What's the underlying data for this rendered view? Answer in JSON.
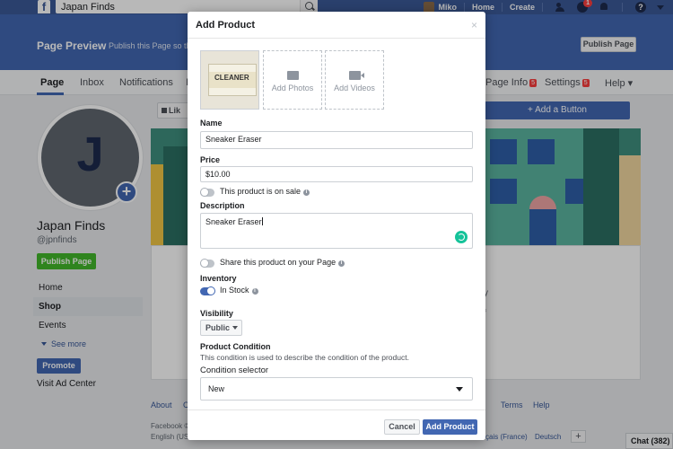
{
  "topbar": {
    "search_value": "Japan Finds",
    "user_name": "Miko",
    "home": "Home",
    "create": "Create",
    "messages_badge": "1"
  },
  "preview": {
    "title": "Page Preview",
    "subtitle": "Publish this Page so tha",
    "publish_label": "Publish Page"
  },
  "nav": {
    "tabs": [
      {
        "label": "Page"
      },
      {
        "label": "Inbox"
      },
      {
        "label": "Notifications"
      },
      {
        "label": "I"
      },
      {
        "label": "Page Info"
      },
      {
        "label": "Settings"
      },
      {
        "label": "Help ▾"
      }
    ],
    "page_info_badge": "5",
    "settings_badge": "5"
  },
  "profile": {
    "initial": "J",
    "name": "Japan Finds",
    "handle": "@jpnfinds",
    "publish_label": "Publish Page"
  },
  "left_nav": {
    "items": [
      {
        "label": "Home"
      },
      {
        "label": "Shop"
      },
      {
        "label": "Events"
      }
    ],
    "see_more": "See more",
    "promote": "Promote",
    "visit_ad": "Visit Ad Center"
  },
  "main": {
    "like_label": "Lik",
    "add_button_label": "+ Add a Button",
    "card_text_1": "y",
    "card_text_2": "f"
  },
  "footer": {
    "about": "About",
    "c": "C",
    "terms": "Terms",
    "help": "Help",
    "copyright": "Facebook ©",
    "english": "English (US",
    "francais": "çais (France)",
    "deutsch": "Deutsch",
    "plus": "+"
  },
  "chat": {
    "label": "Chat (382)"
  },
  "modal": {
    "title": "Add Product",
    "close": "×",
    "thumb_text": "CLEANER",
    "add_photos": "Add Photos",
    "add_videos": "Add Videos",
    "name_label": "Name",
    "name_value": "Sneaker Eraser",
    "price_label": "Price",
    "price_value": "$10.00",
    "on_sale_label": "This product is on sale",
    "description_label": "Description",
    "description_value": "Sneaker Eraser",
    "share_label": "Share this product on your Page",
    "inventory_label": "Inventory",
    "in_stock_label": "In Stock",
    "visibility_label": "Visibility",
    "visibility_value": "Public",
    "condition_label": "Product Condition",
    "condition_desc": "This condition is used to describe the condition of the product.",
    "condition_selector_label": "Condition selector",
    "condition_value": "New",
    "cancel_label": "Cancel",
    "add_label": "Add Product",
    "info_glyph": "i"
  },
  "colors": {
    "fb_blue": "#3b5998",
    "preview_blue": "#4267b2",
    "green": "#42b72a"
  }
}
